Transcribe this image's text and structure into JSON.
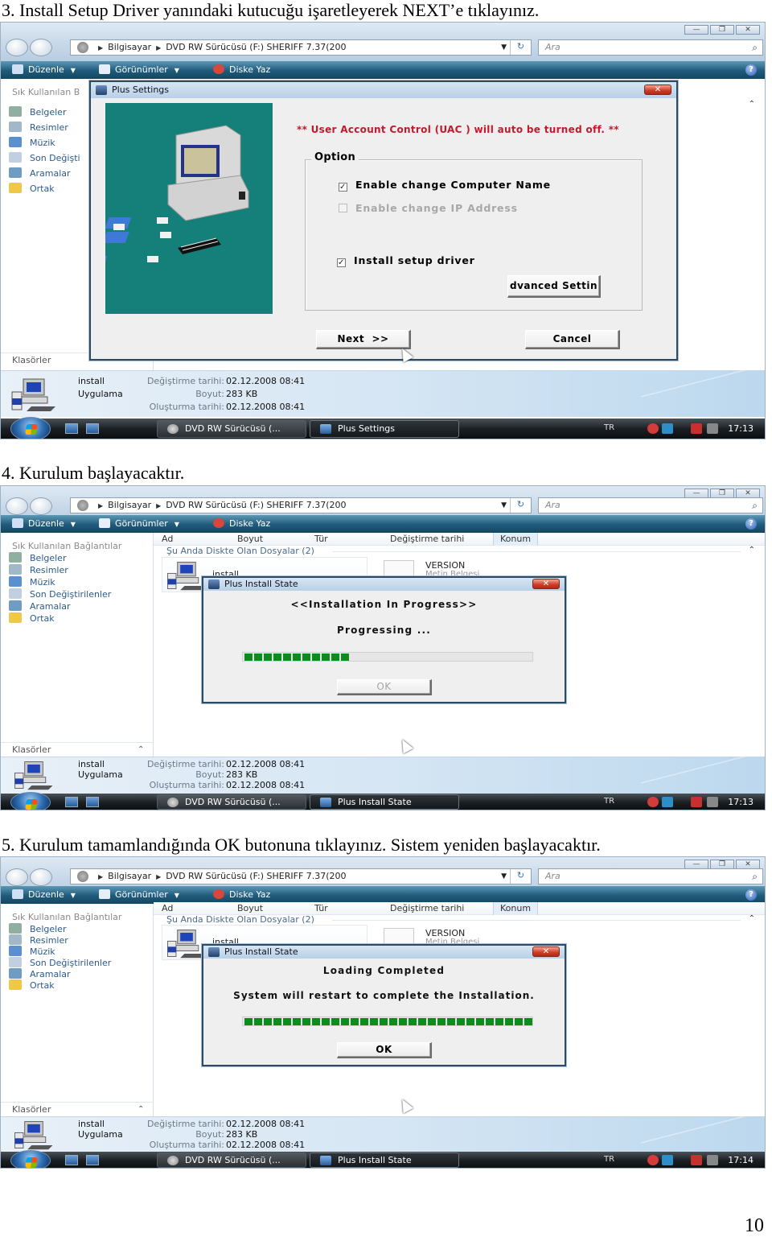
{
  "document": {
    "page_number": "10",
    "steps": [
      {
        "caption": "3. Install Setup Driver yanındaki kutucuğu işaretleyerek NEXT’e tıklayınız.",
        "explorer": {
          "address": {
            "segments": [
              "Bilgisayar",
              "DVD RW Sürücüsü (F:) SHERIFF 7.37(200"
            ]
          },
          "search_placeholder": "Ara",
          "commands": [
            "Düzenle",
            "Görünümler",
            "Diske Yaz"
          ],
          "nav_heading": "Sık Kullanılan B",
          "nav_items": [
            "Belgeler",
            "Resimler",
            "Müzik",
            "Son Değişti",
            "Aramalar",
            "Ortak"
          ],
          "folders_label": "Klasörler",
          "details": {
            "name": "install",
            "type": "Uygulama",
            "modified_label": "Değiştirme tarihi:",
            "modified": "02.12.2008 08:41",
            "size_label": "Boyut:",
            "size": "283 KB",
            "created_label": "Oluşturma tarihi:",
            "created": "02.12.2008 08:41"
          },
          "taskbar": {
            "tasks": [
              "DVD RW Sürücüsü (...",
              "Plus Settings"
            ],
            "language": "TR",
            "clock": "17:13"
          }
        },
        "dialog": {
          "title": "Plus Settings",
          "warning": "** User Account Control (UAC ) will auto be turned off. **",
          "option_legend": "Option",
          "options": [
            {
              "label": "Enable change Computer Name",
              "checked": true,
              "enabled": true
            },
            {
              "label": "Enable change IP Address",
              "checked": false,
              "enabled": false
            },
            {
              "label": "Install setup driver",
              "checked": true,
              "enabled": true
            }
          ],
          "advanced_button": "dvanced Settin",
          "next_button": "Next  >>",
          "cancel_button": "Cancel"
        }
      },
      {
        "caption": "4. Kurulum başlayacaktır.",
        "explorer": {
          "address": {
            "segments": [
              "Bilgisayar",
              "DVD RW Sürücüsü (F:) SHERIFF 7.37(200"
            ]
          },
          "search_placeholder": "Ara",
          "commands": [
            "Düzenle",
            "Görünümler",
            "Diske Yaz"
          ],
          "nav_heading": "Sık Kullanılan Bağlantılar",
          "nav_items": [
            "Belgeler",
            "Resimler",
            "Müzik",
            "Son Değiştirilenler",
            "Aramalar",
            "Ortak"
          ],
          "folders_label": "Klasörler",
          "columns": [
            "Ad",
            "Boyut",
            "Tür",
            "Değiştirme tarihi",
            "Konum"
          ],
          "group_header": "Şu Anda Diskte Olan Dosyalar (2)",
          "files": [
            {
              "name": "install"
            },
            {
              "name": "VERSION",
              "type": "Metin Belgesi"
            }
          ],
          "details": {
            "name": "install",
            "type": "Uygulama",
            "modified_label": "Değiştirme tarihi:",
            "modified": "02.12.2008 08:41",
            "size_label": "Boyut:",
            "size": "283 KB",
            "created_label": "Oluşturma tarihi:",
            "created": "02.12.2008 08:41"
          },
          "taskbar": {
            "tasks": [
              "DVD RW Sürücüsü (...",
              "Plus Install State"
            ],
            "language": "TR",
            "clock": "17:13"
          }
        },
        "dialog": {
          "title": "Plus Install State",
          "heading": "<<Installation In Progress>>",
          "status": "Progressing ...",
          "progress_percent": 35,
          "ok_button": "OK",
          "ok_enabled": false
        }
      },
      {
        "caption": "5. Kurulum tamamlandığında OK butonuna tıklayınız. Sistem yeniden başlayacaktır.",
        "explorer": {
          "address": {
            "segments": [
              "Bilgisayar",
              "DVD RW Sürücüsü (F:) SHERIFF 7.37(200"
            ]
          },
          "search_placeholder": "Ara",
          "commands": [
            "Düzenle",
            "Görünümler",
            "Diske Yaz"
          ],
          "nav_heading": "Sık Kullanılan Bağlantılar",
          "nav_items": [
            "Belgeler",
            "Resimler",
            "Müzik",
            "Son Değiştirilenler",
            "Aramalar",
            "Ortak"
          ],
          "folders_label": "Klasörler",
          "columns": [
            "Ad",
            "Boyut",
            "Tür",
            "Değiştirme tarihi",
            "Konum"
          ],
          "group_header": "Şu Anda Diskte Olan Dosyalar (2)",
          "files": [
            {
              "name": "install"
            },
            {
              "name": "VERSION",
              "type": "Metin Belgesi"
            }
          ],
          "details": {
            "name": "install",
            "type": "Uygulama",
            "modified_label": "Değiştirme tarihi:",
            "modified": "02.12.2008 08:41",
            "size_label": "Boyut:",
            "size": "283 KB",
            "created_label": "Oluşturma tarihi:",
            "created": "02.12.2008 08:41"
          },
          "taskbar": {
            "tasks": [
              "DVD RW Sürücüsü (...",
              "Plus Install State"
            ],
            "language": "TR",
            "clock": "17:14"
          }
        },
        "dialog": {
          "title": "Plus Install State",
          "heading": "Loading Completed",
          "status": "System will restart to complete the Installation.",
          "progress_percent": 100,
          "ok_button": "OK",
          "ok_enabled": true
        }
      }
    ]
  },
  "icons": {
    "nav": [
      "documents-icon",
      "pictures-icon",
      "music-icon",
      "recent-icon",
      "searches-icon",
      "public-icon"
    ],
    "colors": {
      "accent": "#1f5a7c",
      "warning": "#c3192b",
      "progress": "#0f8a1d",
      "splash": "#15807a"
    }
  }
}
